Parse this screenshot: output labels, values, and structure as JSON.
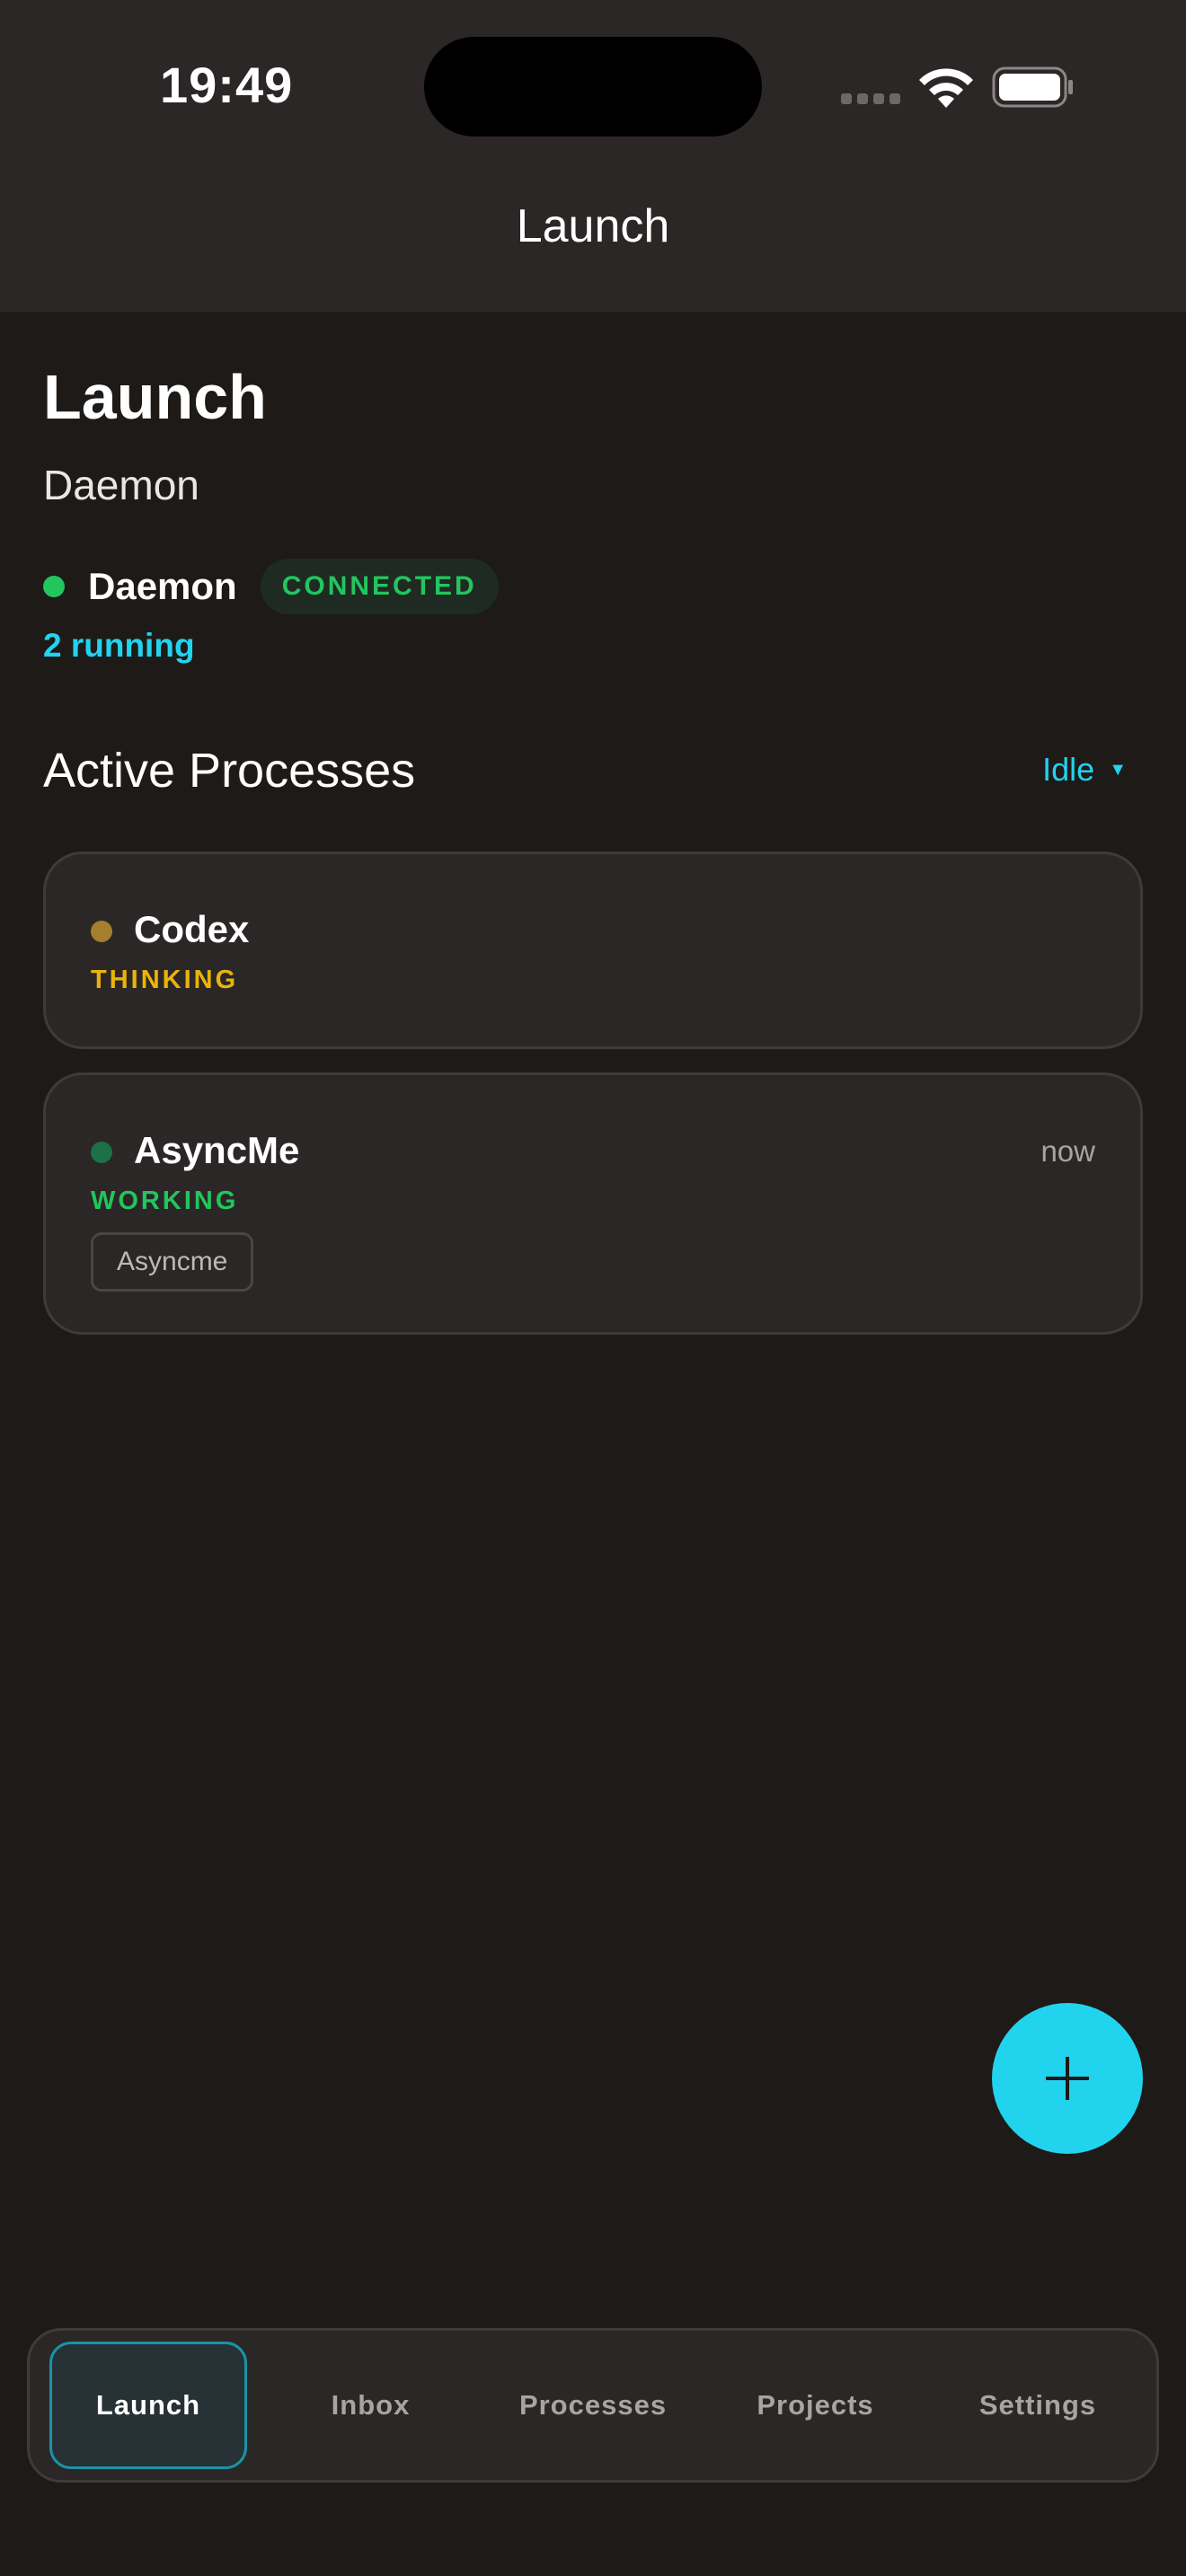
{
  "status_bar": {
    "time": "19:49",
    "icons": [
      "signal-icon",
      "wifi-icon",
      "battery-icon"
    ]
  },
  "nav": {
    "title": "Launch"
  },
  "header": {
    "title": "Launch",
    "subtitle": "Daemon"
  },
  "daemon": {
    "name": "Daemon",
    "status_badge": "CONNECTED",
    "running_text": "2 running",
    "status_color": "#22c55e"
  },
  "processes": {
    "section_title": "Active Processes",
    "filter_value": "Idle",
    "items": [
      {
        "name": "Codex",
        "status": "THINKING",
        "status_color": "#eab308",
        "dot_color": "#a37f2e",
        "time": "",
        "tag": ""
      },
      {
        "name": "AsyncMe",
        "status": "WORKING",
        "status_color": "#22c55e",
        "dot_color": "#1e7046",
        "time": "now",
        "tag": "Asyncme"
      }
    ]
  },
  "fab": {
    "icon": "plus-icon"
  },
  "tabs": [
    {
      "label": "Launch",
      "active": true
    },
    {
      "label": "Inbox",
      "active": false
    },
    {
      "label": "Processes",
      "active": false
    },
    {
      "label": "Projects",
      "active": false
    },
    {
      "label": "Settings",
      "active": false
    }
  ],
  "colors": {
    "accent": "#22d3ee",
    "background": "#1d1a18",
    "surface": "#2a2726"
  }
}
